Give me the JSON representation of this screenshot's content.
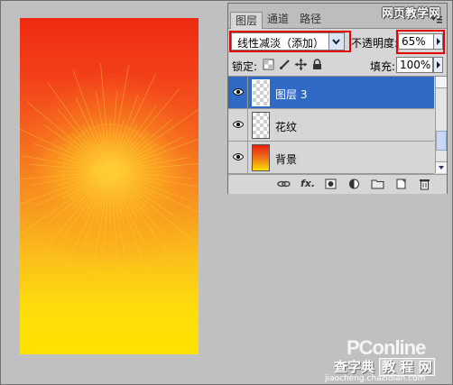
{
  "watermark": {
    "top_right": "网页教学网",
    "pconline": "PConline",
    "site_cn": "查字典",
    "site_box": "教 程 网",
    "site_url": "jiaocheng.chazidian.com"
  },
  "layers_panel": {
    "tabs": [
      "图层",
      "通道",
      "路径"
    ],
    "active_tab": "图层",
    "blend_mode": "线性减淡（添加）",
    "opacity_label": "不透明度:",
    "opacity_value": "65%",
    "lock_label": "锁定:",
    "fill_label": "填充:",
    "fill_value": "100%",
    "layers": [
      {
        "name": "图层 3",
        "selected": true,
        "visible": true,
        "thumb": "checker"
      },
      {
        "name": "花纹",
        "selected": false,
        "visible": true,
        "thumb": "checker"
      },
      {
        "name": "背景",
        "selected": false,
        "visible": true,
        "thumb": "gradient"
      }
    ],
    "bottom_icons": [
      "link-icon",
      "fx-icon",
      "mask-icon",
      "adjustment-icon",
      "group-folder-icon",
      "new-layer-icon",
      "trash-icon"
    ],
    "highlight_color": "#3169c6",
    "callout_color": "#e50000"
  },
  "canvas": {
    "colors": [
      "#ee2a12",
      "#f7961f",
      "#ffe200"
    ]
  }
}
